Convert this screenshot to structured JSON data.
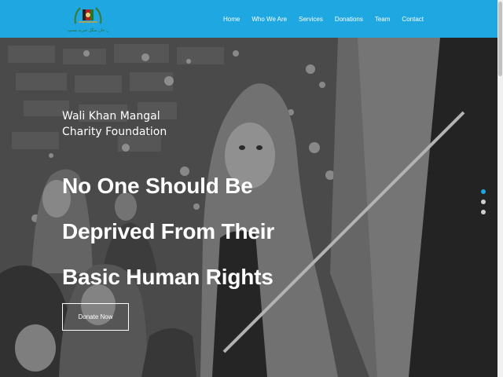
{
  "header": {
    "logo_text": "ولي خان منگل خیریه بنسټ",
    "nav": [
      "Home",
      "Who We Are",
      "Services",
      "Donations",
      "Team",
      "Contact"
    ]
  },
  "hero": {
    "foundation_lines": [
      "Wali Khan Mangal",
      "Charity Foundation"
    ],
    "headline_lines": [
      "No One Should Be",
      "Deprived From Their",
      "Basic Human Rights"
    ],
    "donate_label": "Donate Now",
    "slider_dots": 3,
    "active_dot": 0
  },
  "colors": {
    "header_bg": "#1ea7e1",
    "text": "#ffffff",
    "dot_active": "#1ea7e1",
    "dot_inactive": "#cfcfcf"
  }
}
